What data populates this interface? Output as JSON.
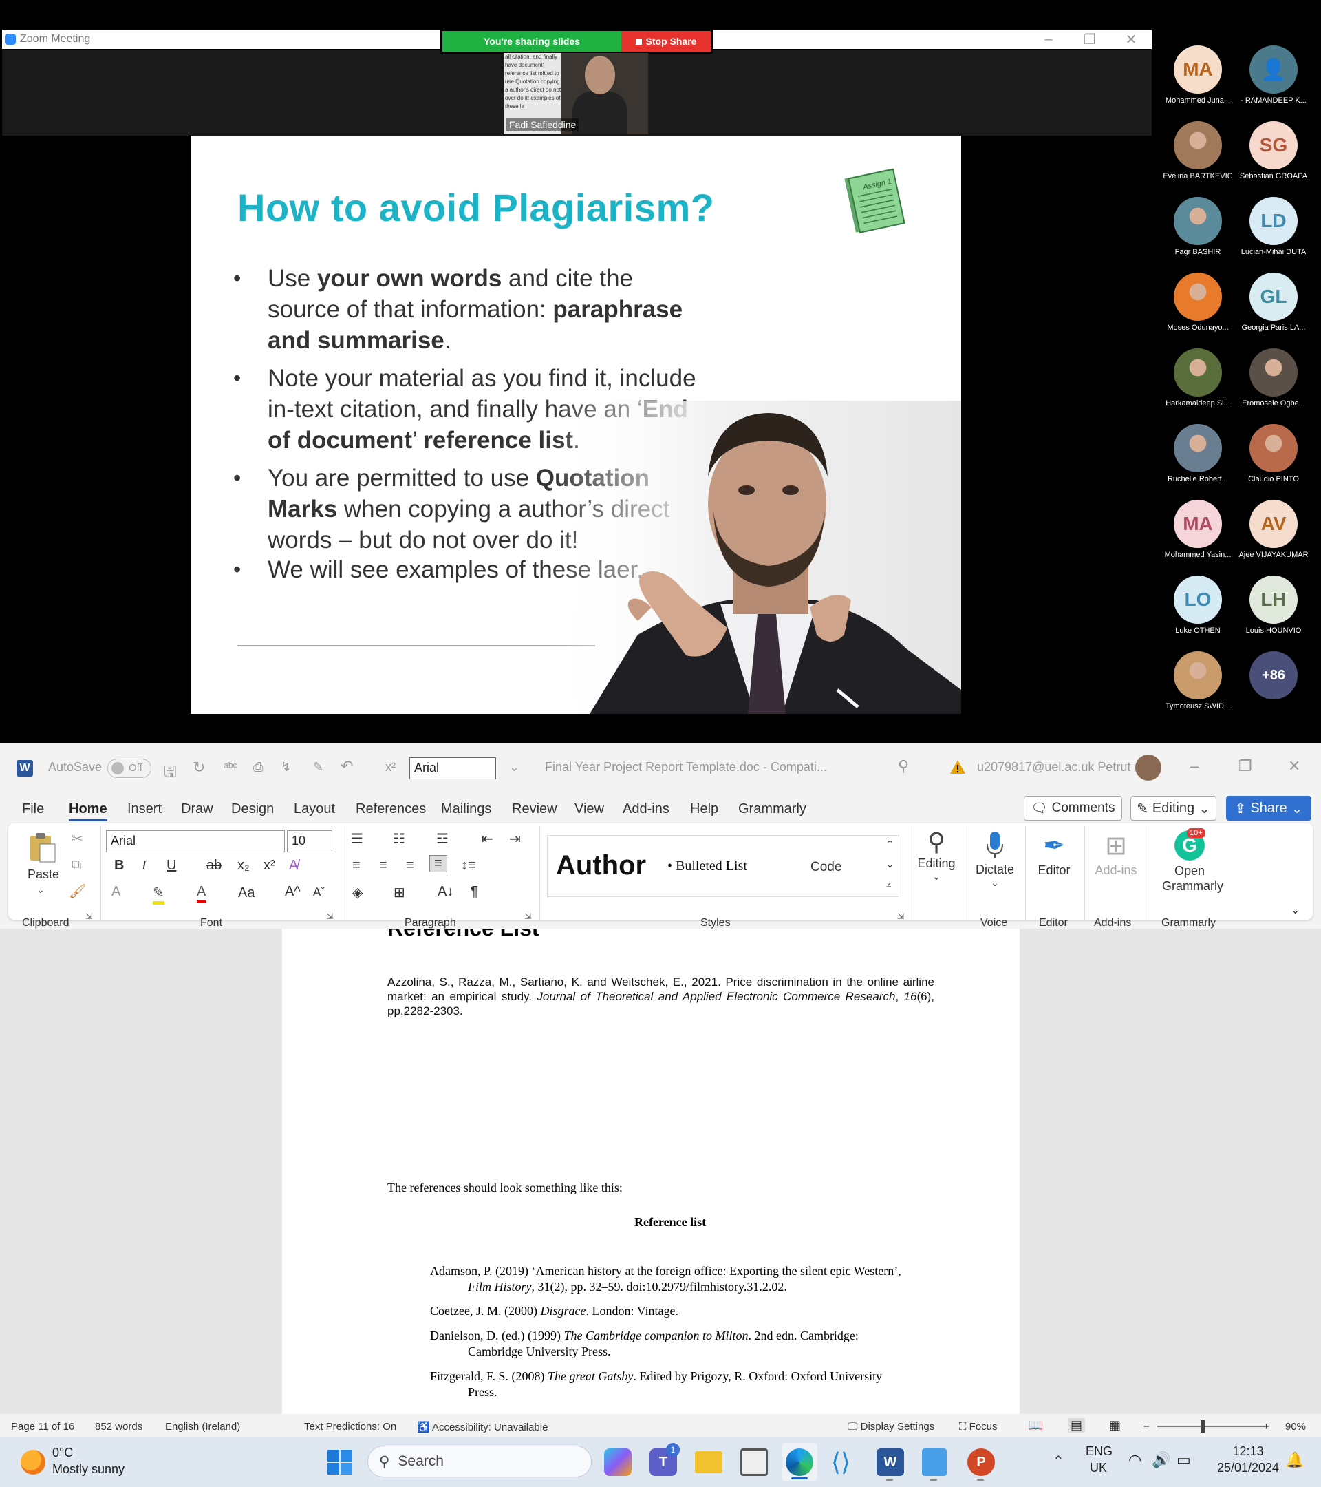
{
  "zoom": {
    "window_title": "Zoom Meeting",
    "share_status": "You're sharing slides",
    "stop_share": "Stop Share",
    "speaker_name": "Fadi Safieddine",
    "thumb_text": "all citation, and finally have document' reference list mitted to use Quotation copying a author's direct do not over do it! examples of these la"
  },
  "slide": {
    "title": "How to avoid Plagiarism?",
    "assign_label": "Assign 1",
    "bullets": [
      {
        "parts": [
          [
            "Use ",
            false
          ],
          [
            "your own words",
            true
          ],
          [
            " and cite the source of that information: ",
            false
          ],
          [
            "paraphrase and summarise",
            true
          ],
          [
            ".",
            false
          ]
        ]
      },
      {
        "parts": [
          [
            "Note your material as you find it, include in-text citation, and finally have an ‘",
            false
          ],
          [
            "End of document",
            true
          ],
          [
            "’ ",
            false
          ],
          [
            "reference list",
            true
          ],
          [
            ".",
            false
          ]
        ]
      },
      {
        "parts": [
          [
            "You are permitted to use ",
            false
          ],
          [
            "Quotation Marks",
            true
          ],
          [
            " when copying a author’s direct words – but do not over do it!",
            false
          ]
        ]
      },
      {
        "parts": [
          [
            "We will see examples of these la",
            false
          ],
          [
            "er.",
            false
          ]
        ]
      }
    ]
  },
  "participants": [
    {
      "initials": "MA",
      "name": "Mohammed Juna...",
      "bg": "#f6ddc9",
      "fg": "#b5651d"
    },
    {
      "initials": "",
      "name": "- RAMANDEEP K...",
      "bg": "#4a7a8c",
      "fg": "#ffffff",
      "icon": "person-icon"
    },
    {
      "initials": "",
      "name": "Evelina BARTKEVIC",
      "bg": "#a0785a",
      "fg": "#ffffff",
      "photo": true
    },
    {
      "initials": "SG",
      "name": "Sebastian GROAPA",
      "bg": "#f6d8cd",
      "fg": "#b4563a"
    },
    {
      "initials": "",
      "name": "Fagr BASHIR",
      "bg": "#5b8a9a",
      "fg": "#ffffff",
      "photo": true
    },
    {
      "initials": "LD",
      "name": "Lucian-Mihai DUTA",
      "bg": "#d9ecf5",
      "fg": "#3d8db3"
    },
    {
      "initials": "",
      "name": "Moses Odunayo...",
      "bg": "#e87a2b",
      "fg": "#ffffff",
      "photo": true
    },
    {
      "initials": "GL",
      "name": "Georgia Paris LA...",
      "bg": "#d9ecf2",
      "fg": "#3d8ea3"
    },
    {
      "initials": "",
      "name": "Harkamaldeep Si...",
      "bg": "#5a6e3c",
      "fg": "#ffffff",
      "photo": true
    },
    {
      "initials": "",
      "name": "Eromosele Ogbe...",
      "bg": "#5a5048",
      "fg": "#ffffff",
      "photo": true
    },
    {
      "initials": "",
      "name": "Ruchelle Robert...",
      "bg": "#6a7e92",
      "fg": "#ffffff",
      "photo": true
    },
    {
      "initials": "",
      "name": "Claudio PINTO",
      "bg": "#b86a4a",
      "fg": "#ffffff",
      "photo": true
    },
    {
      "initials": "MA",
      "name": "Mohammed Yasin...",
      "bg": "#f5d5da",
      "fg": "#b04a60"
    },
    {
      "initials": "AV",
      "name": "Ajee VIJAYAKUMAR",
      "bg": "#f6dccc",
      "fg": "#b5651d"
    },
    {
      "initials": "LO",
      "name": "Luke OTHEN",
      "bg": "#d7ebf5",
      "fg": "#3d8db3"
    },
    {
      "initials": "LH",
      "name": "Louis HOUNVIO",
      "bg": "#e1e8dc",
      "fg": "#5a6e4e"
    },
    {
      "initials": "",
      "name": "Tymoteusz SWID...",
      "bg": "#c99a6a",
      "fg": "#ffffff",
      "photo": true
    },
    {
      "initials": "+86",
      "name": "",
      "bg": "#4a4f7a",
      "fg": "#ffffff"
    }
  ],
  "word": {
    "autosave": "AutoSave",
    "autosave_state": "Off",
    "font_quick": "Arial",
    "doc_title": "Final Year Project Report Template.doc  -  Compati...",
    "account": "u2079817@uel.ac.uk Petrut",
    "menu": [
      "File",
      "Home",
      "Insert",
      "Draw",
      "Design",
      "Layout",
      "References",
      "Mailings",
      "Review",
      "View",
      "Add-ins",
      "Help",
      "Grammarly"
    ],
    "comments": "Comments",
    "editing_mode": "Editing",
    "share": "Share",
    "ribbon": {
      "paste": "Paste",
      "font_name": "Arial",
      "font_size": "10",
      "style_author": "Author",
      "style_bulleted": "Bulleted List",
      "style_code": "Code",
      "editing": "Editing",
      "dictate": "Dictate",
      "editor": "Editor",
      "addins": "Add-ins",
      "open_grammarly": "Open Grammarly",
      "grammarly_badge": "10+",
      "groups": [
        "Clipboard",
        "Font",
        "Paragraph",
        "Styles",
        "Voice",
        "Editor",
        "Add-ins",
        "Grammarly"
      ]
    },
    "document": {
      "heading": "Reference List",
      "azzolina": "Azzolina, S., Razza, M., Sartiano, K. and Weitschek, E., 2021. Price discrimination in the online airline market: an empirical study.",
      "azzolina_journal": "Journal of Theoretical and Applied Electronic Commerce Research",
      "azzolina_vol": "16",
      "azzolina_tail": "(6), pp.2282-2303.",
      "intro": "The references should look something like this:",
      "reflist_title": "Reference list",
      "refs": [
        {
          "pre": "Adamson, P. (2019) ‘American history at the foreign office: Exporting the silent epic Western’, ",
          "it": "Film History",
          "post": ", 31(2), pp. 32–59. doi:10.2979/filmhistory.31.2.02."
        },
        {
          "pre": "Coetzee, J. M. (2000) ",
          "it": "Disgrace",
          "post": ". London: Vintage."
        },
        {
          "pre": "Danielson, D. (ed.) (1999) ",
          "it": "The Cambridge companion to Milton",
          "post": ". 2nd edn. Cambridge: Cambridge University Press."
        },
        {
          "pre": "Fitzgerald, F. S. (2008) ",
          "it": "The great Gatsby",
          "post": ". Edited by Prigozy, R. Oxford: Oxford University Press."
        }
      ]
    },
    "status": {
      "page": "Page 11 of 16",
      "words": "852 words",
      "language": "English (Ireland)",
      "predictions": "Text Predictions: On",
      "accessibility": "Accessibility: Unavailable",
      "display": "Display Settings",
      "focus": "Focus",
      "zoom": "90%"
    }
  },
  "taskbar": {
    "temp": "0°C",
    "weather": "Mostly sunny",
    "search": "Search",
    "teams_badge": "1",
    "lang1": "ENG",
    "lang2": "UK",
    "time": "12:13",
    "date": "25/01/2024"
  }
}
